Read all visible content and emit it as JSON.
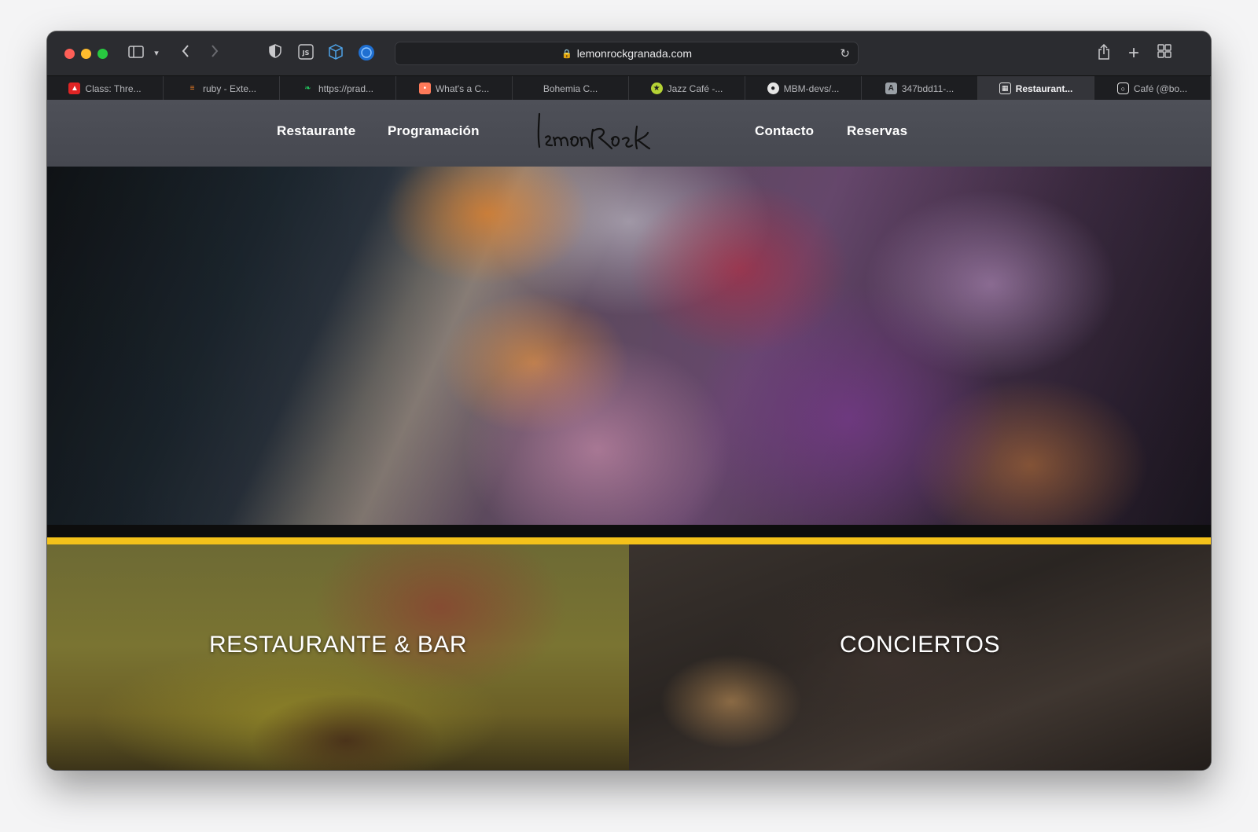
{
  "browser": {
    "address": "lemonrockgranada.com",
    "tabs": [
      {
        "label": "Class: Thre...",
        "icon": "red-hat-icon",
        "color": "#e02424",
        "active": false
      },
      {
        "label": "ruby - Exte...",
        "icon": "stackoverflow-icon",
        "color": "#f48024",
        "active": false
      },
      {
        "label": "https://prad...",
        "icon": "leaf-icon",
        "color": "#22c55e",
        "active": false
      },
      {
        "label": "What's a C...",
        "icon": "hubspot-icon",
        "color": "#ff7a59",
        "active": false
      },
      {
        "label": "Bohemia C...",
        "icon": "",
        "color": "",
        "active": false
      },
      {
        "label": "Jazz Café -...",
        "icon": "star-badge-icon",
        "color": "#b5d335",
        "active": false
      },
      {
        "label": "MBM-devs/...",
        "icon": "github-icon",
        "color": "#e5e5e5",
        "active": false
      },
      {
        "label": "347bdd11-...",
        "icon": "letter-a-icon",
        "color": "#9aa0a6",
        "active": false
      },
      {
        "label": "Restaurant...",
        "icon": "qr-icon",
        "color": "#e5e5e5",
        "active": true
      },
      {
        "label": "Café (@bo...",
        "icon": "instagram-icon",
        "color": "#e5e5e5",
        "active": false
      }
    ]
  },
  "site": {
    "logo_text": "lemonRock",
    "nav": {
      "restaurante": "Restaurante",
      "programacion": "Programación",
      "contacto": "Contacto",
      "reservas": "Reservas"
    },
    "cards": {
      "restaurante": "RESTAURANTE & BAR",
      "conciertos": "CONCIERTOS"
    },
    "accent_color": "#f4c21a"
  }
}
